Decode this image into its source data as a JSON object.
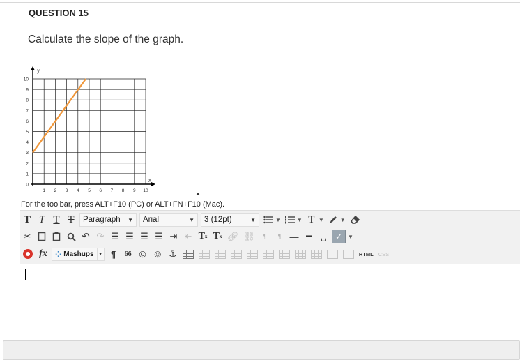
{
  "question": {
    "title": "QUESTION 15",
    "prompt": "Calculate the slope of the graph."
  },
  "chart_data": {
    "type": "line",
    "x": [
      0,
      4.7
    ],
    "y": [
      3,
      10
    ],
    "series": [
      {
        "x": [
          0,
          4.7
        ],
        "y": [
          3,
          10
        ],
        "color": "#f0973a"
      }
    ],
    "xlabel": "x",
    "ylabel": "y",
    "xlim": [
      0,
      10
    ],
    "ylim": [
      0,
      10
    ],
    "x_ticks": [
      "1",
      "2",
      "3",
      "4",
      "5",
      "6",
      "7",
      "8",
      "9",
      "10"
    ],
    "y_ticks": [
      "0",
      "1",
      "2",
      "3",
      "4",
      "5",
      "6",
      "7",
      "8",
      "9",
      "10"
    ],
    "grid": true
  },
  "editor": {
    "toolbar_hint": "For the toolbar, press ALT+F10 (PC) or ALT+FN+F10 (Mac).",
    "row1": {
      "bold": "T",
      "italic": "T",
      "underline": "T",
      "strike": "T",
      "format_select": "Paragraph",
      "font_select": "Arial",
      "size_select": "3 (12pt)",
      "bullet_list_icon": "bulleted-list-icon",
      "numbered_list_icon": "numbered-list-icon",
      "text_color": "T",
      "highlight_icon": "pen-icon",
      "clear_format_icon": "eraser-icon"
    },
    "row2": {
      "superscript": "T",
      "superscript_mark": "x",
      "subscript": "T",
      "subscript_mark": "x",
      "pilcrow_ltr": "¶",
      "pilcrow_rtl": "¶"
    },
    "row3": {
      "mashups_label": "Mashups",
      "pilcrow": "¶",
      "quote": "66",
      "copyright": "©",
      "emoticon": "☺",
      "anchor": "⚓",
      "html_label": "HTML",
      "css_label": "CSS",
      "fx_label": "fx"
    },
    "content": ""
  }
}
